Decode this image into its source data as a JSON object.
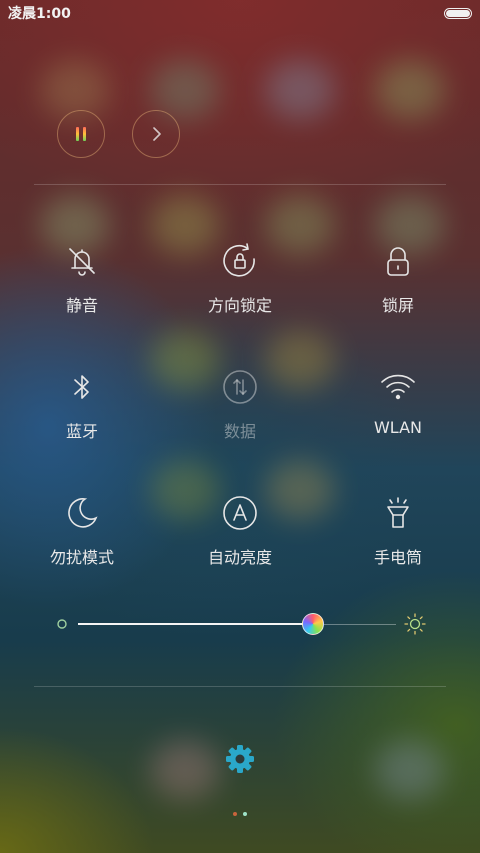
{
  "status_bar": {
    "time": "凌晨1:00"
  },
  "media": {
    "pause_icon": "pause-icon",
    "next_icon": "chevron-right-icon"
  },
  "toggles": [
    {
      "id": "mute",
      "label": "静音",
      "icon": "bell-off-icon",
      "enabled": true
    },
    {
      "id": "rotation-lock",
      "label": "方向锁定",
      "icon": "rotation-lock-icon",
      "enabled": true
    },
    {
      "id": "lock-screen",
      "label": "锁屏",
      "icon": "lock-icon",
      "enabled": true
    },
    {
      "id": "bluetooth",
      "label": "蓝牙",
      "icon": "bluetooth-icon",
      "enabled": true
    },
    {
      "id": "data",
      "label": "数据",
      "icon": "mobile-data-icon",
      "enabled": false
    },
    {
      "id": "wlan",
      "label": "WLAN",
      "icon": "wifi-icon",
      "enabled": true
    },
    {
      "id": "dnd",
      "label": "勿扰模式",
      "icon": "moon-icon",
      "enabled": true
    },
    {
      "id": "auto-brightness",
      "label": "自动亮度",
      "icon": "auto-brightness-icon",
      "enabled": true
    },
    {
      "id": "flashlight",
      "label": "手电筒",
      "icon": "flashlight-icon",
      "enabled": true
    }
  ],
  "brightness": {
    "level": 0.74
  },
  "settings": {
    "icon": "gear-icon"
  },
  "pager": {
    "pages": 2,
    "current": 2
  },
  "colors": {
    "accent": "#2aa7c9",
    "page_dot_inactive": "#c8643c",
    "page_dot_active": "#9fe3c8"
  }
}
